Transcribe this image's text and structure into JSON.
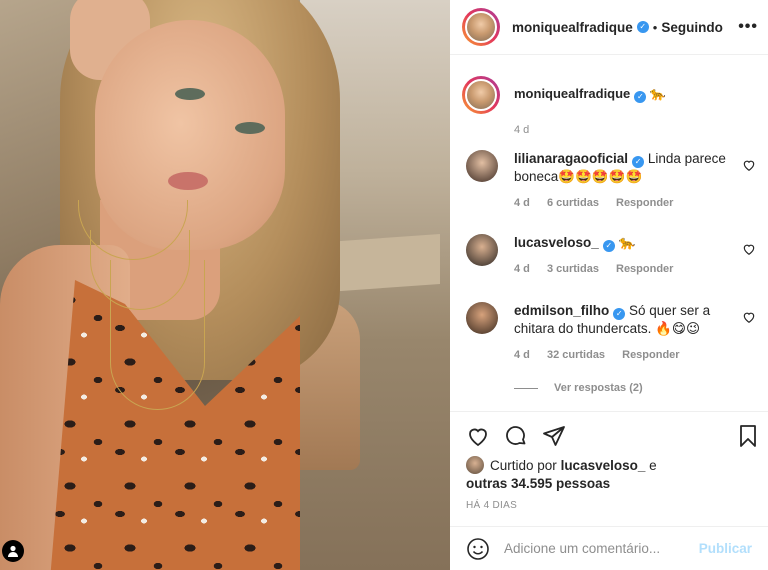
{
  "post": {
    "author": "moniquealfradique",
    "follow_status": "Seguindo",
    "dot": "•",
    "more": "•••",
    "caption_emoji": "🐆",
    "caption_time": "4 d"
  },
  "comments": [
    {
      "user": "lilianaragaooficial",
      "text": "Linda parece boneca",
      "emoji": "🤩🤩🤩🤩🤩",
      "time": "4 d",
      "likes": "6 curtidas",
      "reply": "Responder"
    },
    {
      "user": "lucasveloso_",
      "text": "",
      "emoji": "🐆",
      "time": "4 d",
      "likes": "3 curtidas",
      "reply": "Responder"
    },
    {
      "user": "edmilson_filho",
      "text": "Só quer ser a chitara do thundercats.",
      "emoji": "🔥😋😉",
      "time": "4 d",
      "likes": "32 curtidas",
      "reply": "Responder"
    }
  ],
  "view_replies": "Ver respostas (2)",
  "likes": {
    "prefix": "Curtido por",
    "user": "lucasveloso_",
    "suffix": "e",
    "others": "outras 34.595 pessoas"
  },
  "date": "HÁ 4 DIAS",
  "composer": {
    "placeholder": "Adicione um comentário...",
    "publish": "Publicar"
  },
  "colors": {
    "verified": "#3897f0",
    "muted": "#8e8e8e",
    "publish_disabled": "#b2dffc"
  }
}
